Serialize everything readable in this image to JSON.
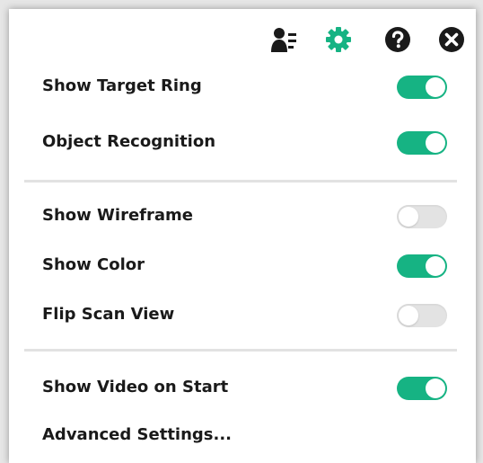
{
  "toolbar": {
    "icons": [
      {
        "name": "profile-list-icon",
        "color": "#1a1a1a"
      },
      {
        "name": "settings-gear-icon",
        "color": "#16b383"
      },
      {
        "name": "help-icon",
        "color": "#1a1a1a"
      },
      {
        "name": "close-icon",
        "color": "#1a1a1a"
      }
    ]
  },
  "settings": {
    "show_target_ring": {
      "label": "Show Target Ring",
      "enabled": true
    },
    "object_recognition": {
      "label": "Object Recognition",
      "enabled": true
    },
    "show_wireframe": {
      "label": "Show Wireframe",
      "enabled": false
    },
    "show_color": {
      "label": "Show Color",
      "enabled": true
    },
    "flip_scan_view": {
      "label": "Flip Scan View",
      "enabled": false
    },
    "show_video_on_start": {
      "label": "Show Video on Start",
      "enabled": true
    },
    "advanced_settings": {
      "label": "Advanced Settings..."
    }
  },
  "colors": {
    "accent": "#16b383",
    "toggle_off": "#e3e3e3",
    "text": "#1a1a1a"
  }
}
